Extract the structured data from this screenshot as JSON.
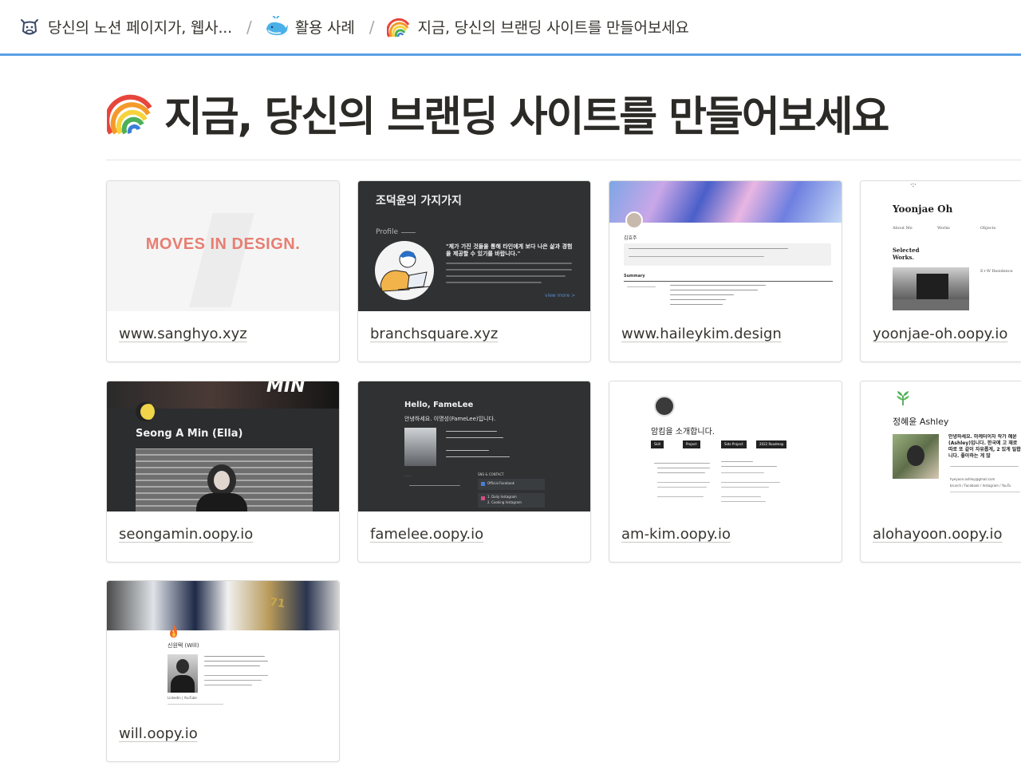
{
  "breadcrumb": [
    {
      "label": "당신의 노션 페이지가, 웹사...",
      "icon": "cow-icon"
    },
    {
      "label": "활용 사례",
      "icon": "whale-icon"
    },
    {
      "label": "지금, 당신의 브랜딩 사이트를 만들어보세요",
      "icon": "rainbow-icon"
    }
  ],
  "breadcrumb_separator": "/",
  "page": {
    "title": "지금, 당신의 브랜딩 사이트를 만들어보세요",
    "icon": "rainbow-icon"
  },
  "gallery": [
    {
      "label": "www.sanghyo.xyz",
      "preview": {
        "headline": "MOVES IN DESIGN."
      }
    },
    {
      "label": "branchsquare.xyz",
      "preview": {
        "headline": "조덕윤의 가지가지",
        "section": "Profile",
        "quote": "\"제가 가진 것들을 통해 타인에게 보다 나은 삶과 경험을 제공할 수 있기를 바랍니다.\"",
        "link": "view more >"
      }
    },
    {
      "label": "www.haileykim.design",
      "preview": {
        "name": "김효주",
        "section": "Summary"
      }
    },
    {
      "label": "yoonjae-oh.oopy.io",
      "preview": {
        "headline": "Yoonjae Oh",
        "nav": [
          "About Me",
          "Works",
          "Objects"
        ],
        "section": "Selected Works.",
        "caption": "E+W Residence"
      }
    },
    {
      "label": "seongamin.oopy.io",
      "preview": {
        "headline": "Seong A Min (Ella)"
      }
    },
    {
      "label": "famelee.oopy.io",
      "preview": {
        "headline": "Hello, FameLee",
        "intro": "안녕하세요. 이명성(FameLee)입니다.",
        "contact": "SNS & CONTACT",
        "items": [
          "Official Facebook",
          "1. Daily Instagram",
          "2. Cooking Instagram"
        ]
      }
    },
    {
      "label": "am-kim.oopy.io",
      "preview": {
        "headline": "암킴을 소개합니다.",
        "tags": [
          "Skill",
          "Project",
          "Side Project",
          "2022 Roadmap"
        ]
      }
    },
    {
      "label": "alohayoon.oopy.io",
      "preview": {
        "headline": "정혜윤 Ashley",
        "intro": "안녕하세요. 마케터이자 작가 혜윤(Ashley)입니다. 한국에 고 재로 따로 또 같이 자유롭게, 2 있게 일합니다. 좋아하는 게 많",
        "email": "hyeyoon.ashley@gmail.com",
        "links": "brunch / Facebook / Instagram / YouTu"
      }
    },
    {
      "label": "will.oopy.io",
      "preview": {
        "name": "신원택 (Will)",
        "links": "Linkedin | YouTube"
      }
    }
  ]
}
